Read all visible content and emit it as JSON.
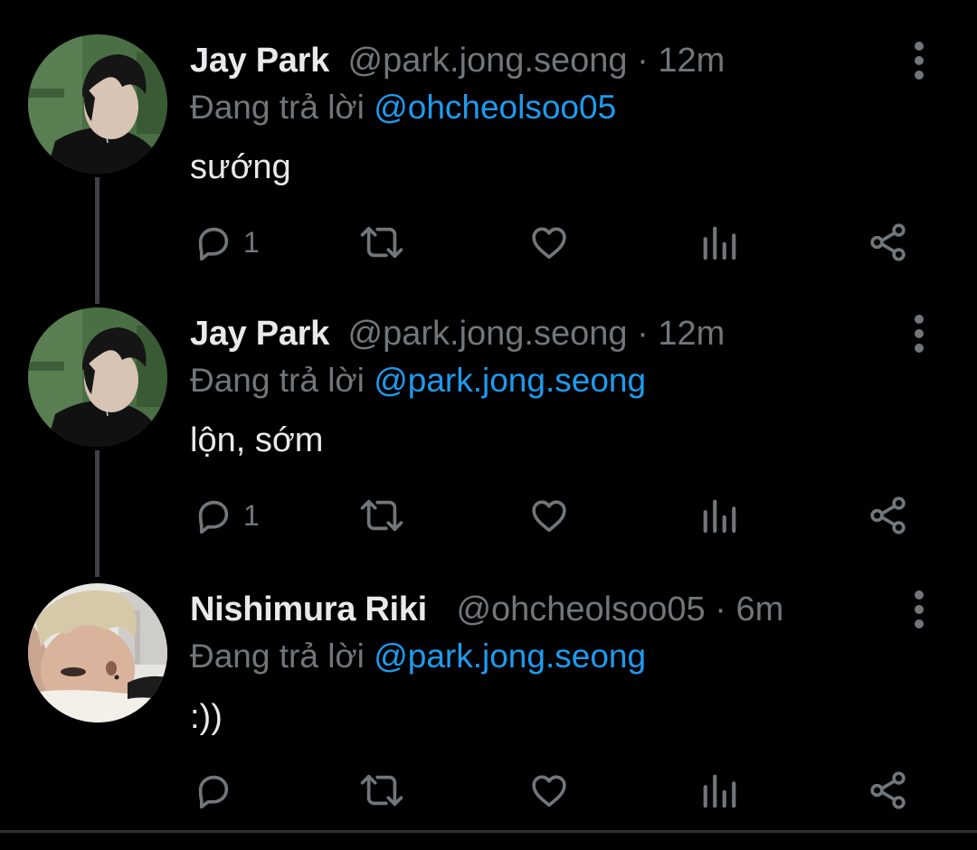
{
  "colors": {
    "background": "#000000",
    "text_primary": "#e7e9ea",
    "text_secondary": "#71767b",
    "link": "#1d9bf0",
    "thread_line": "#3e4144"
  },
  "tweets": [
    {
      "display_name": "Jay Park",
      "handle": "@park.jong.seong",
      "separator": "·",
      "time": "12m",
      "reply_prefix": "Đang trả lời",
      "reply_to": "@ohcheolsoo05",
      "text": "sướng",
      "reply_count": "1",
      "avatar_icon": "avatar-jay-park",
      "more_icon": "more-vertical-icon"
    },
    {
      "display_name": "Jay Park",
      "handle": "@park.jong.seong",
      "separator": "·",
      "time": "12m",
      "reply_prefix": "Đang trả lời",
      "reply_to": "@park.jong.seong",
      "text": "lộn, sớm",
      "reply_count": "1",
      "avatar_icon": "avatar-jay-park",
      "more_icon": "more-vertical-icon"
    },
    {
      "display_name": "Nishimura Riki",
      "handle": "@ohcheolsoo05",
      "separator": "·",
      "time": "6m",
      "reply_prefix": "Đang trả lời",
      "reply_to": "@park.jong.seong",
      "text": ":))",
      "reply_count": "",
      "avatar_icon": "avatar-nishimura-riki",
      "more_icon": "more-vertical-icon"
    }
  ],
  "action_icons": [
    "reply-icon",
    "retweet-icon",
    "like-icon",
    "analytics-icon",
    "share-icon"
  ]
}
